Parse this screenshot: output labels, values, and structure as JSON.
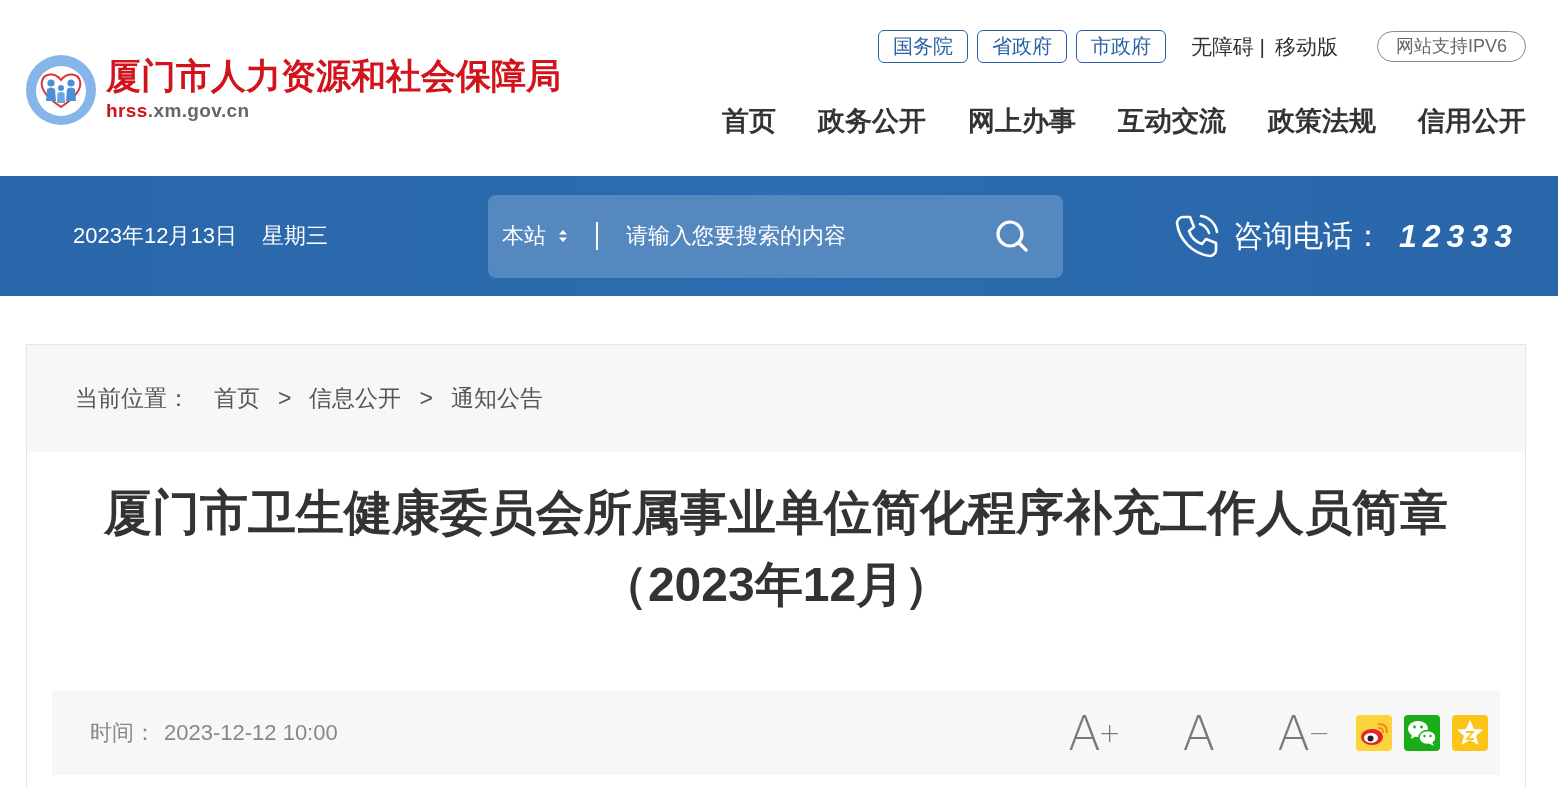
{
  "header": {
    "logo": {
      "title": "厦门市人力资源和社会保障局",
      "domain_highlight": "hrss",
      "domain_rest": ".xm.gov.cn"
    },
    "gov_links": [
      {
        "label": "国务院"
      },
      {
        "label": "省政府"
      },
      {
        "label": "市政府"
      }
    ],
    "utility_links": [
      {
        "label": "无障碍"
      },
      {
        "label": "移动版"
      }
    ],
    "utility_separator": "|",
    "ipv6_badge": "网站支持IPV6",
    "nav": [
      {
        "label": "首页"
      },
      {
        "label": "政务公开"
      },
      {
        "label": "网上办事"
      },
      {
        "label": "互动交流"
      },
      {
        "label": "政策法规"
      },
      {
        "label": "信用公开"
      }
    ]
  },
  "banner": {
    "date": "2023年12月13日",
    "weekday": "星期三",
    "search": {
      "scope": "本站",
      "placeholder": "请输入您要搜索的内容"
    },
    "hotline": {
      "label": "咨询电话：",
      "number": "12333"
    }
  },
  "article": {
    "breadcrumb": {
      "label": "当前位置：",
      "items": [
        {
          "text": "首页"
        },
        {
          "separator": ">",
          "text": "信息公开"
        },
        {
          "separator": ">",
          "text": "通知公告"
        }
      ]
    },
    "title": "厦门市卫生健康委员会所属事业单位简化程序补充工作人员简章（2023年12月）",
    "meta": {
      "time_label": "时间：",
      "time": "2023-12-12 10:00",
      "font_sizes": [
        {
          "kind": "increase",
          "letter": "A",
          "sign": "+"
        },
        {
          "kind": "reset",
          "letter": "A"
        },
        {
          "kind": "decrease",
          "letter": "A",
          "sign": "−"
        }
      ],
      "share": [
        {
          "kind": "weibo"
        },
        {
          "kind": "wechat"
        },
        {
          "kind": "qzone"
        }
      ]
    }
  }
}
